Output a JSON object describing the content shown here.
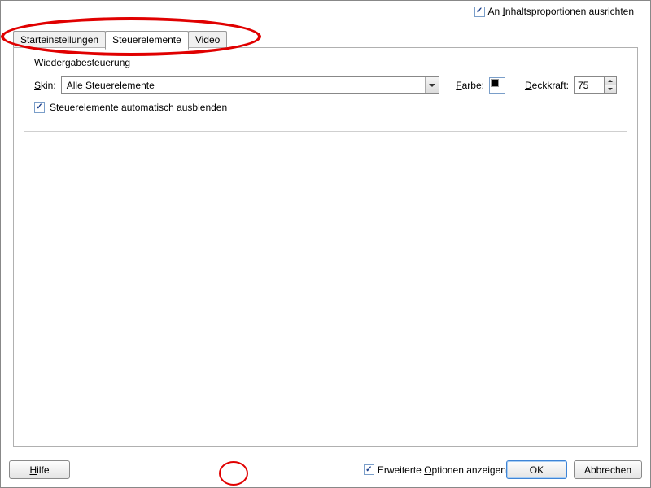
{
  "top_checkbox": {
    "label": "An Inhaltsproportionen ausrichten",
    "underline": "I",
    "checked": true
  },
  "tabs": {
    "items": [
      {
        "label": "Starteinstellungen",
        "active": false
      },
      {
        "label": "Steuerelemente",
        "active": true
      },
      {
        "label": "Video",
        "active": false
      }
    ]
  },
  "group": {
    "title": "Wiedergabesteuerung",
    "skin_label": "Skin:",
    "skin_underline": "S",
    "skin_value": "Alle Steuerelemente",
    "color_label": "Farbe:",
    "color_underline": "F",
    "opacity_label": "Deckkraft:",
    "opacity_underline": "D",
    "opacity_value": "75",
    "autohide_label": "Steuerelemente automatisch ausblenden",
    "autohide_checked": true
  },
  "footer": {
    "help": "Hilfe",
    "help_underline": "H",
    "adv_label": "Erweiterte Optionen anzeigen",
    "adv_underline": "O",
    "adv_checked": true,
    "ok": "OK",
    "cancel": "Abbrechen"
  }
}
